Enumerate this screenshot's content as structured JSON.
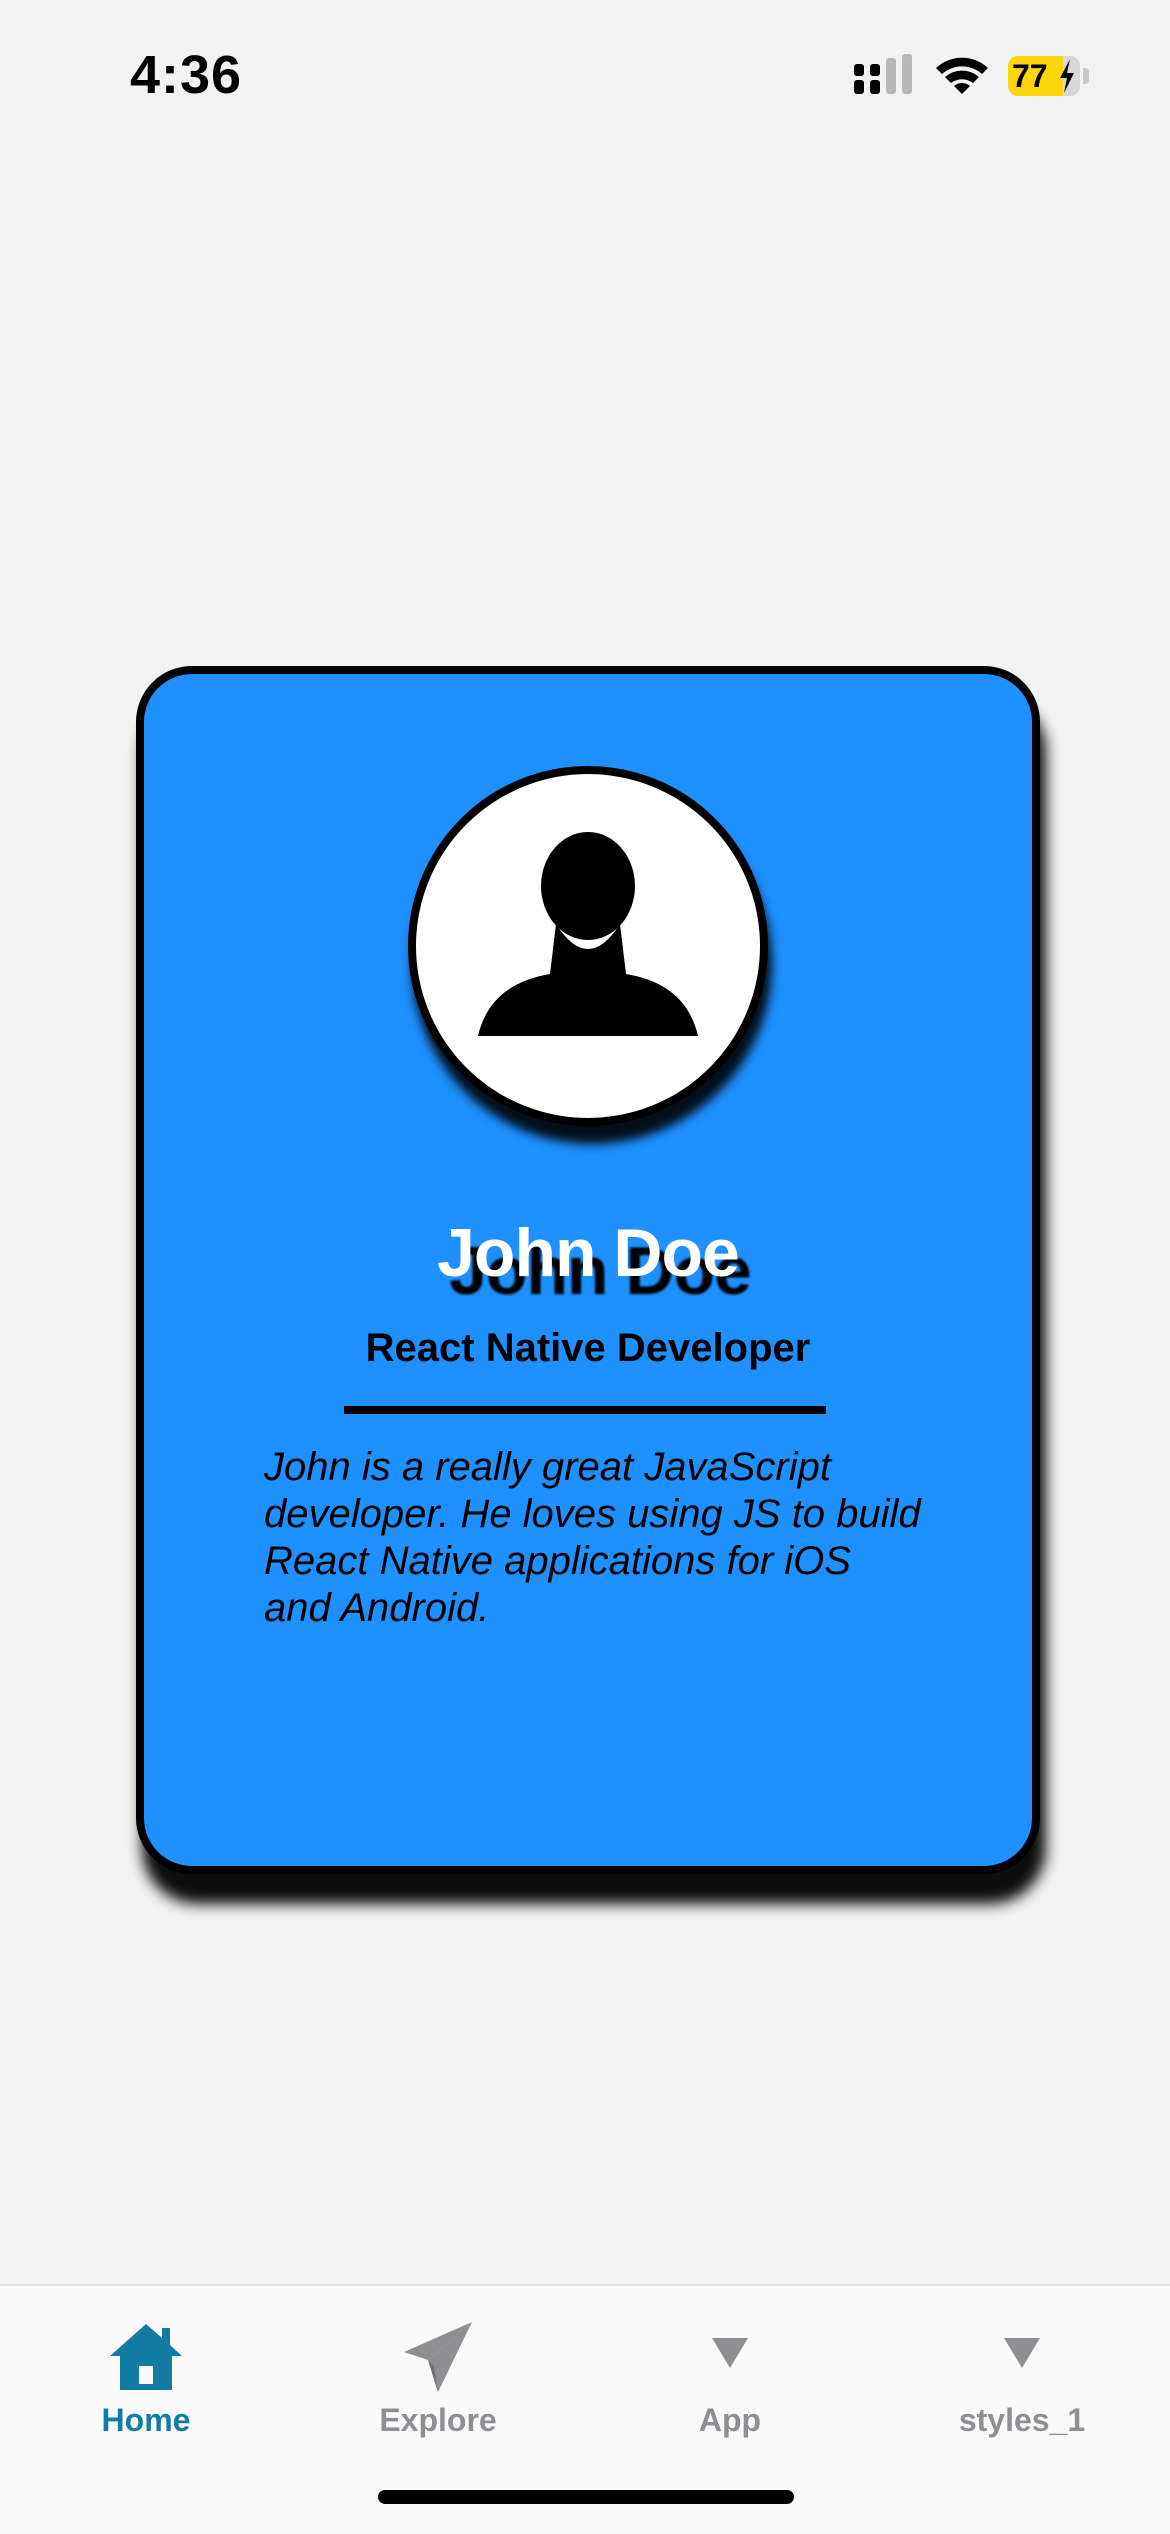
{
  "status_bar": {
    "time": "4:36",
    "battery_level": "77",
    "battery_fraction": 0.77,
    "battery_color": "#ffd60a",
    "icons": [
      "signal-icon",
      "wifi-icon",
      "battery-icon",
      "charging-bolt-icon"
    ]
  },
  "card": {
    "background_color": "#1e90ff",
    "avatar_icon": "person-silhouette-icon",
    "name": "John Doe",
    "role": "React Native Developer",
    "bio": "John is a really great JavaScript developer. He loves using JS to build React Native applications for iOS and Android."
  },
  "tab_bar": {
    "active_color": "#127ca3",
    "inactive_color": "#8e8e93",
    "active_tab": "Home",
    "tabs": [
      {
        "label": "Home",
        "icon": "home-icon"
      },
      {
        "label": "Explore",
        "icon": "paper-plane-icon"
      },
      {
        "label": "App",
        "icon": "triangle-down-icon"
      },
      {
        "label": "styles_1",
        "icon": "triangle-down-icon"
      }
    ]
  }
}
